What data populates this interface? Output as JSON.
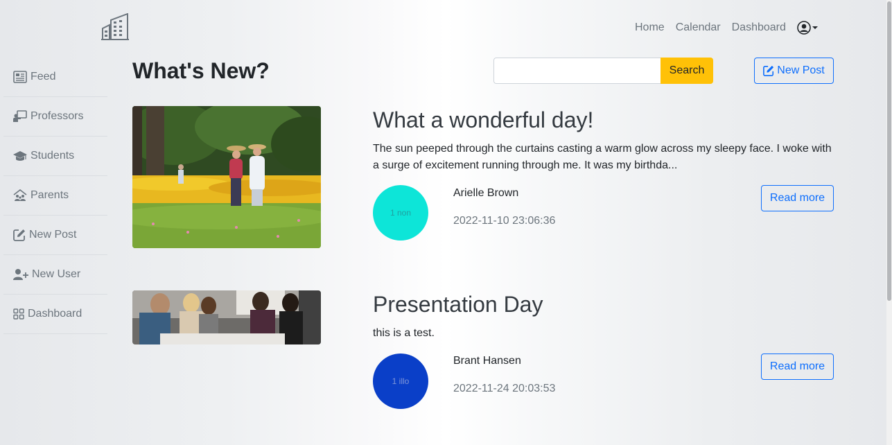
{
  "brand": {
    "logo_icon": "building-icon"
  },
  "nav": {
    "home": "Home",
    "calendar": "Calendar",
    "dashboard": "Dashboard",
    "user_icon": "user-circle-icon"
  },
  "sidebar": {
    "items": [
      {
        "label": "Feed",
        "icon": "newspaper-icon"
      },
      {
        "label": "Professors",
        "icon": "chalkboard-teacher-icon"
      },
      {
        "label": "Students",
        "icon": "graduation-cap-icon"
      },
      {
        "label": "Parents",
        "icon": "family-house-icon"
      },
      {
        "label": "New Post",
        "icon": "edit-icon"
      },
      {
        "label": "New User",
        "icon": "user-plus-icon"
      },
      {
        "label": "Dashboard",
        "icon": "grid-icon"
      }
    ]
  },
  "main": {
    "title": "What's New?",
    "search": {
      "value": "",
      "placeholder": "",
      "button_label": "Search"
    },
    "new_post_label": "New Post"
  },
  "posts": [
    {
      "title": "What a wonderful day!",
      "excerpt": "The sun peeped through the curtains casting a warm glow across my sleepy face. I woke with a surge of excitement running through me. It was my birthda...",
      "avatar_text": "1 non",
      "avatar_color": "#0de5d8",
      "author": "Arielle Brown",
      "date": "2022-11-10 23:06:36",
      "read_more": "Read more"
    },
    {
      "title": "Presentation Day",
      "excerpt": "this is a test.",
      "avatar_text": "1 illo",
      "avatar_color": "#0a3fc8",
      "author": "Brant Hansen",
      "date": "2022-11-24 20:03:53",
      "read_more": "Read more"
    }
  ],
  "colors": {
    "primary": "#0d6efd",
    "warning": "#ffc107",
    "muted": "#6c757d"
  }
}
